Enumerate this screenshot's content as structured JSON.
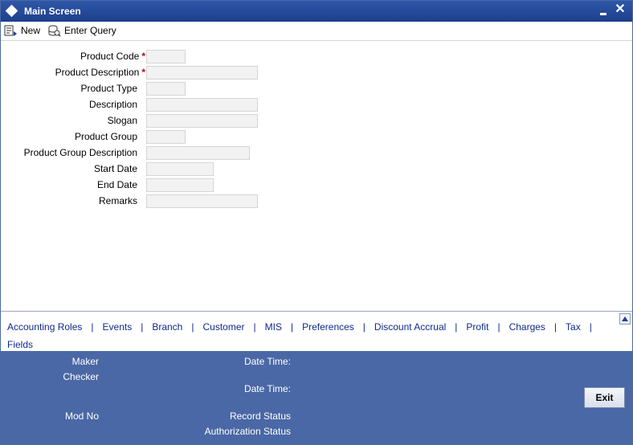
{
  "window": {
    "title": "Main Screen"
  },
  "toolbar": {
    "new_label": "New",
    "enter_query_label": "Enter Query"
  },
  "form": {
    "product_code_label": "Product Code",
    "product_description_label": "Product Description",
    "product_type_label": "Product Type",
    "description_label": "Description",
    "slogan_label": "Slogan",
    "product_group_label": "Product Group",
    "product_group_description_label": "Product Group Description",
    "start_date_label": "Start Date",
    "end_date_label": "End Date",
    "remarks_label": "Remarks",
    "required_marker": "*"
  },
  "tabs": [
    "Accounting Roles",
    "Events",
    "Branch",
    "Customer",
    "MIS",
    "Preferences",
    "Discount Accrual",
    "Profit",
    "Charges",
    "Tax",
    "Fields"
  ],
  "tab_separator": "|",
  "footer": {
    "maker_label": "Maker",
    "checker_label": "Checker",
    "date_time_label_1": "Date Time:",
    "date_time_label_2": "Date Time:",
    "mod_no_label": "Mod No",
    "record_status_label": "Record Status",
    "authorization_status_label": "Authorization Status",
    "exit_label": "Exit"
  },
  "colors": {
    "title_bar": "#1d3f8c",
    "footer_background": "#4a68a5",
    "tab_link": "#0e2b8a",
    "required": "#c00000"
  }
}
